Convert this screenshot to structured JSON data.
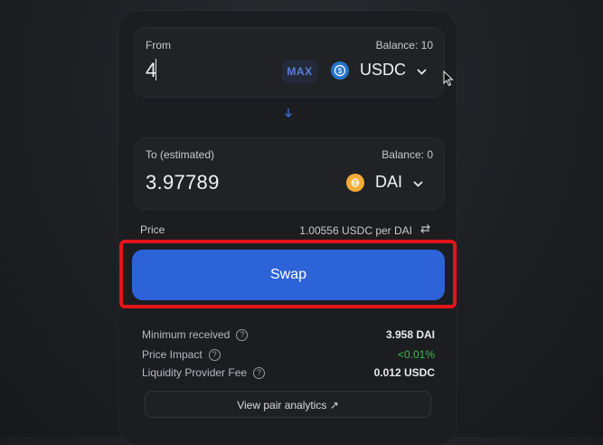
{
  "from": {
    "label": "From",
    "balance": "Balance: 10",
    "amount": "4",
    "max_label": "MAX",
    "token": "USDC",
    "token_icon": "usdc-coin-icon"
  },
  "to": {
    "label": "To (estimated)",
    "balance": "Balance: 0",
    "amount": "3.97789",
    "token": "DAI",
    "token_icon": "dai-coin-icon"
  },
  "price": {
    "label": "Price",
    "value": "1.00556 USDC per DAI"
  },
  "swap_label": "Swap",
  "details": {
    "min_received_label": "Minimum received",
    "min_received_value": "3.958 DAI",
    "price_impact_label": "Price Impact",
    "price_impact_value": "<0.01%",
    "lp_fee_label": "Liquidity Provider Fee",
    "lp_fee_value": "0.012 USDC"
  },
  "analytics_label": "View pair analytics ↗",
  "colors": {
    "accent": "#2c63d8",
    "highlight": "#e3141a",
    "positive": "#3fb950",
    "usdc": "#2775ca",
    "dai": "#f5ac37"
  }
}
